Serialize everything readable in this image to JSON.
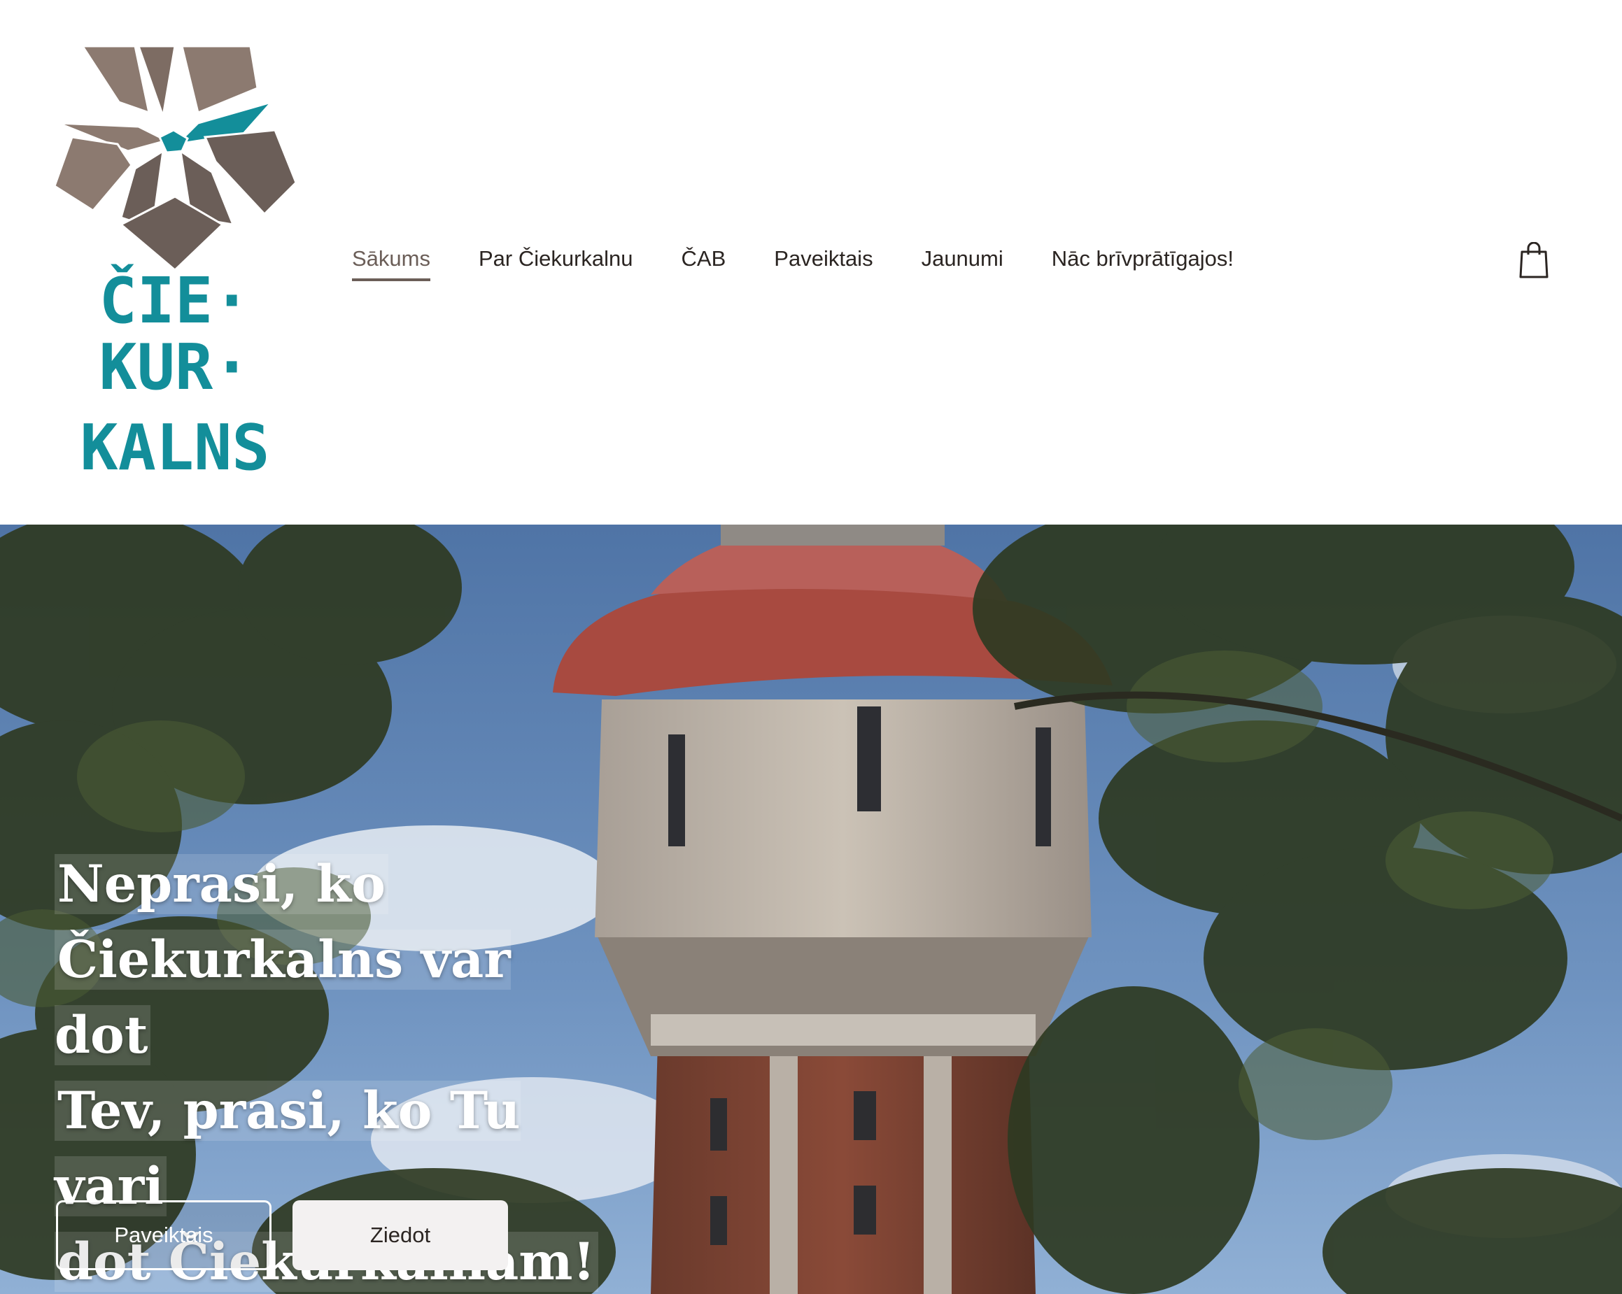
{
  "brand": {
    "logo_lines": [
      "ČIE·",
      "KUR·",
      "KALNS"
    ],
    "colors": {
      "brown_dark": "#6b5e58",
      "brown_light": "#8c7a70",
      "teal": "#138e9a"
    }
  },
  "nav": {
    "items": [
      {
        "label": "Sākums",
        "active": true
      },
      {
        "label": "Par Čiekurkalnu",
        "active": false
      },
      {
        "label": "ČAB",
        "active": false
      },
      {
        "label": "Paveiktais",
        "active": false
      },
      {
        "label": "Jaunumi",
        "active": false
      },
      {
        "label": "Nāc brīvprātīgajos!",
        "active": false
      }
    ],
    "cart_icon": "shopping-bag-icon"
  },
  "hero": {
    "title_lines": [
      "Neprasi, ko",
      "Čiekurkalns var dot",
      "Tev, prasi, ko Tu vari",
      "dot Čiekurkalnam!"
    ],
    "buttons": {
      "primary_label": "Paveiktais",
      "secondary_label": "Ziedot"
    }
  }
}
